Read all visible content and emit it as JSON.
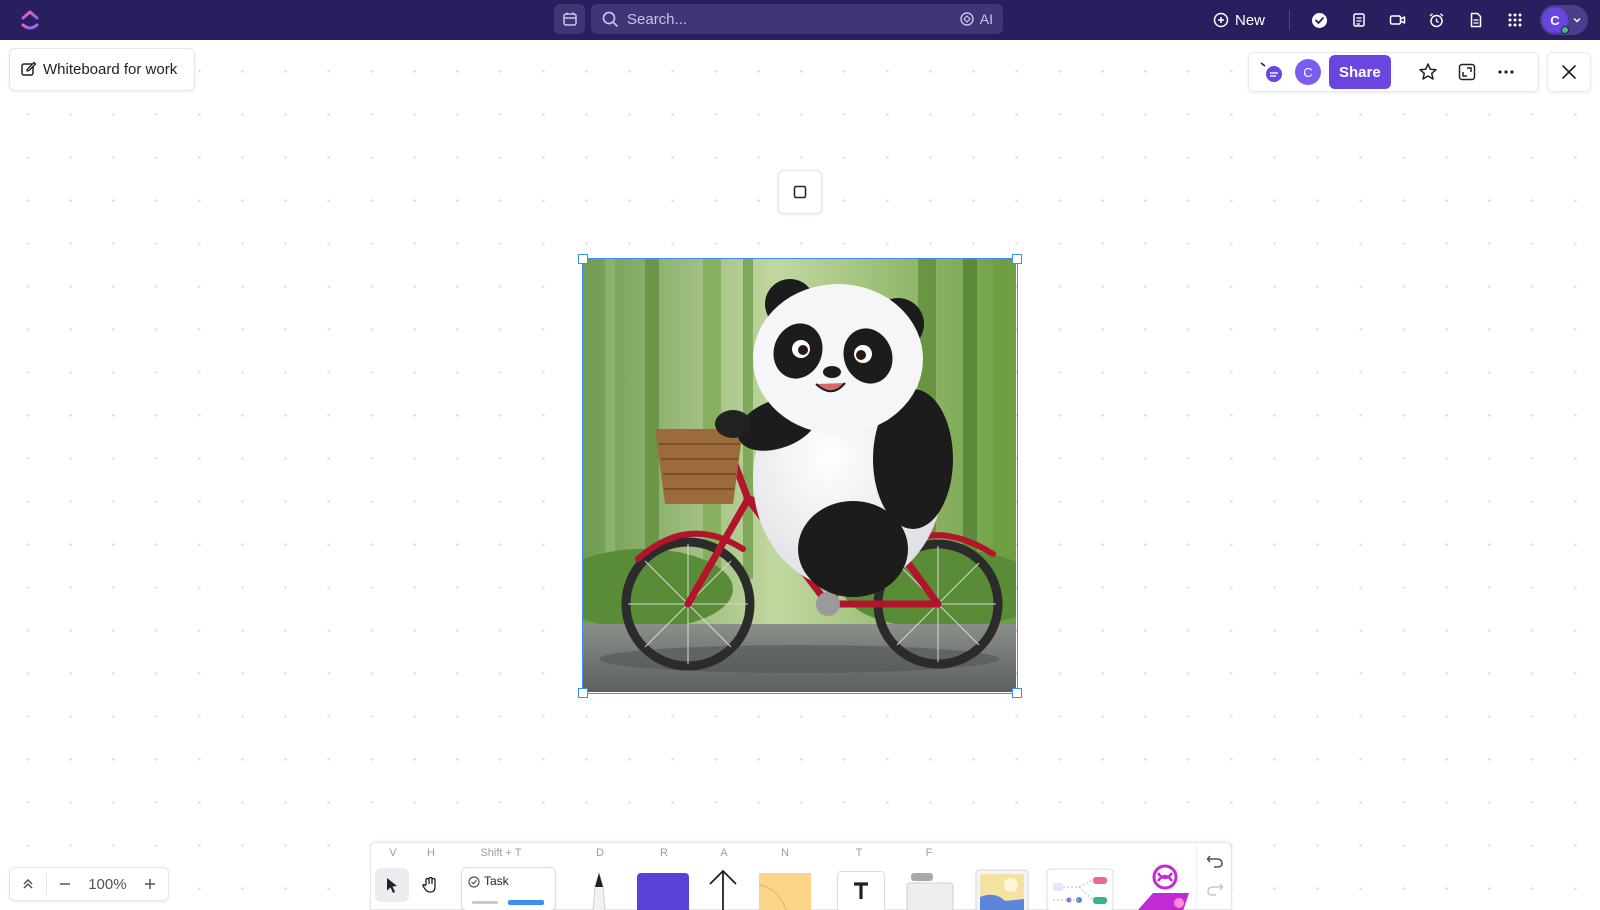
{
  "topbar": {
    "search_placeholder": "Search...",
    "ai_label": "AI",
    "new_label": "New",
    "user_initial": "C",
    "icons": [
      "calendar-icon",
      "search-icon",
      "ai-icon",
      "plus-circle-icon",
      "check-circle-icon",
      "notepad-icon",
      "video-icon",
      "alarm-icon",
      "doc-icon",
      "grid-icon",
      "chevron-down-icon"
    ]
  },
  "board": {
    "title": "Whiteboard for work"
  },
  "collab": {
    "avatar_initial": "C",
    "share_label": "Share"
  },
  "image": {
    "subject": "panda-on-bicycle"
  },
  "zoom": {
    "level": "100%"
  },
  "toolbar": {
    "keys": {
      "select": "V",
      "hand": "H",
      "task": "Shift + T",
      "draw": "D",
      "rectangle": "R",
      "arrow": "A",
      "note": "N",
      "text": "T",
      "frame": "F"
    },
    "task_label": "Task",
    "shape_color": "#5b3fd9"
  },
  "colors": {
    "topbar": "#2a1f5e",
    "accent": "#6a45e0",
    "selection": "#3d8df5"
  }
}
